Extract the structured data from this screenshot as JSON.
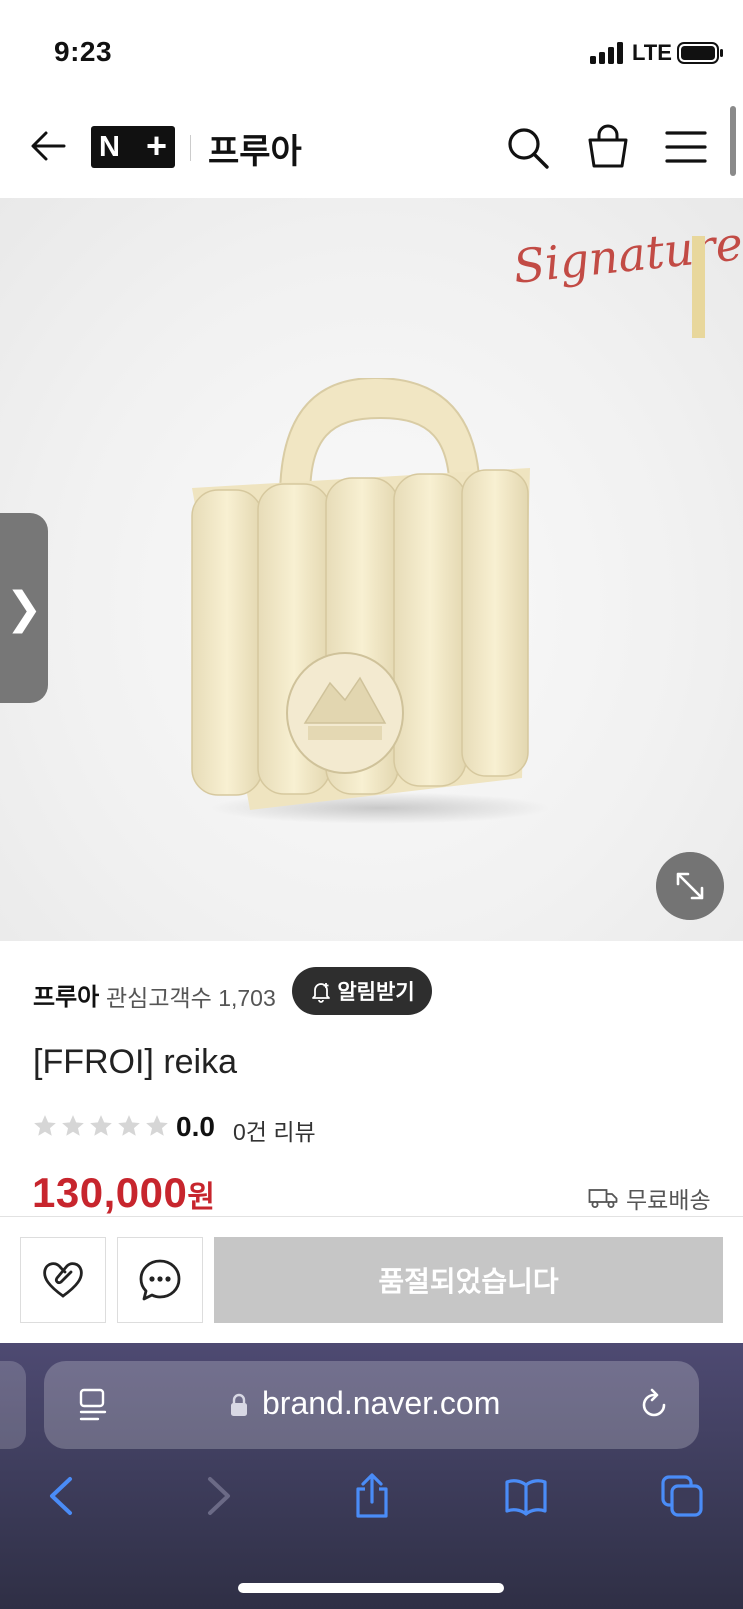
{
  "status_bar": {
    "time": "9:23",
    "network": "LTE"
  },
  "header": {
    "logo_text": "N+",
    "store_name": "프루아"
  },
  "hero": {
    "signature_text": "Signature"
  },
  "store": {
    "name": "프루아",
    "followers_label": "관심고객수 1,703",
    "alarm_label": "알림받기"
  },
  "product": {
    "name": "[FFROI] reika",
    "rating": "0.0",
    "rating_fraction": 0,
    "review_label": "0건 리뷰",
    "price": "130,000",
    "currency": "원",
    "shipping": "무료배송"
  },
  "actions": {
    "soldout_label": "품절되었습니다"
  },
  "browser": {
    "url": "brand.naver.com"
  },
  "colors": {
    "price": "#c7252d",
    "soldout_bg": "#c6c6c6",
    "safari_accent": "#4a8cf7"
  },
  "icons": [
    "back-arrow-icon",
    "search-icon",
    "cart-icon",
    "menu-icon",
    "expand-icon",
    "bell-icon",
    "heart-check-icon",
    "chat-icon",
    "truck-icon",
    "reader-icon",
    "lock-icon",
    "reload-icon",
    "share-icon",
    "bookmarks-icon",
    "tabs-icon"
  ]
}
